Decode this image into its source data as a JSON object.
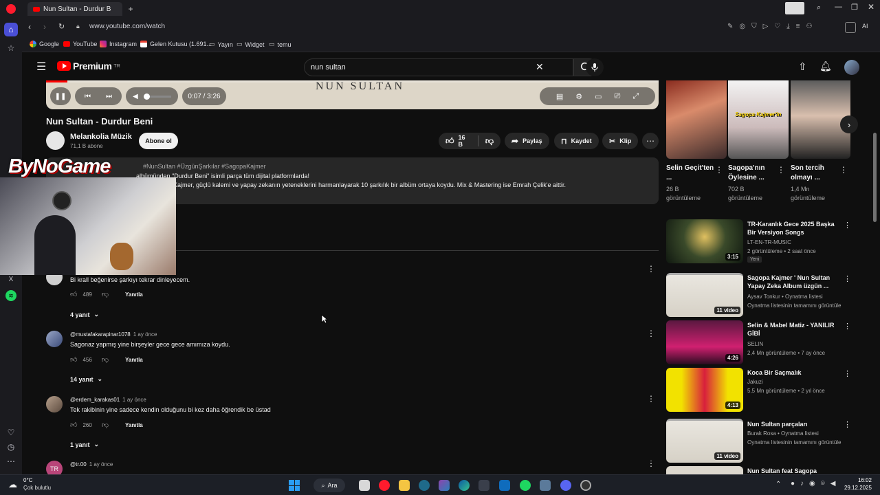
{
  "browser": {
    "tab_title": "Nun Sultan - Durdur B",
    "url": "www.youtube.com/watch",
    "bookmarks": [
      "Google",
      "YouTube",
      "Instagram",
      "Gelen Kutusu (1.691...",
      "Yayın",
      "Widget",
      "temu"
    ],
    "ai_label": "AI"
  },
  "header": {
    "logo": "Premium",
    "logo_region": "TR",
    "search_value": "nun sultan"
  },
  "player": {
    "time": "0:07 / 3:26",
    "video_banner": "NUN SULTAN",
    "progress": 0.035
  },
  "video": {
    "title": "Nun Sultan - Durdur Beni",
    "channel": "Melankolia Müzik",
    "subscribers": "71,1 B abone",
    "subscribe_label": "Abone ol",
    "likes": "16 B",
    "share_label": "Paylaş",
    "save_label": "Kaydet",
    "clip_label": "Klip"
  },
  "description": {
    "tags": "#NunSultan #ÜzgünŞarkılar #SagopaKajmer",
    "line1": "isimli parça tüm dijital platformlarda!",
    "line1_quote": "\"Durdur Beni\"",
    "line1_prefix": "albümünden",
    "line2": "Kajmer, güçlü kalemi ve yapay zekanın yeteneklerini harmanlayarak 10 şarkılık bir albüm ortaya koydu. Mix & Mastering ise Emrah Çelik'e aittir."
  },
  "overlay": {
    "brand": "ByNoGame"
  },
  "comments": [
    {
      "author": "",
      "time": "",
      "text": "Bi krall beğenirse şarkıyı tekrar dinleyecem.",
      "likes": "489",
      "reply_label": "Yanıtla",
      "replies": "4 yanıt"
    },
    {
      "author": "@mustafakarapinar1078",
      "time": "1 ay önce",
      "text": "Sagonaz yapmış yine birşeyler gece gece amımıza koydu.",
      "likes": "456",
      "reply_label": "Yanıtla",
      "replies": "14 yanıt"
    },
    {
      "author": "@erdem_karakas01",
      "time": "1 ay önce",
      "text": "Tek rakibinin yine sadece kendin olduğunu bi kez daha öğrendik be üstad",
      "likes": "260",
      "reply_label": "Yanıtla",
      "replies": "1 yanıt"
    },
    {
      "author": "@tr.00",
      "time": "1 ay önce",
      "text": "",
      "likes": "",
      "reply_label": "",
      "replies": "",
      "initials": "TR"
    }
  ],
  "shorts": [
    {
      "title": "Selin Geçit'ten ...",
      "views": "26 B görüntüleme"
    },
    {
      "title": "Sagopa'nın Öylesine ...",
      "views": "702 B görüntüleme"
    },
    {
      "title": "Son tercih olmayı ...",
      "views": "1,4 Mn görüntüleme"
    }
  ],
  "shorts_thumb_text": "Sagopa Kajmer'in",
  "recommendations": [
    {
      "title": "TR-Karanlık Gece 2025 Başka Bir Versiyon Songs",
      "channel": "LT-EN-TR-MUSIC",
      "meta": "2 görüntüleme • 2 saat önce",
      "badge": "Yeni",
      "duration": "3:15"
    },
    {
      "title": "Sagopa Kajmer ' Nun Sultan Yapay Zeka Album üzgün ...",
      "channel": "Aysav Tonkur • Oynatma listesi",
      "meta": "Oynatma listesinin tamamını görüntüle",
      "badge": "",
      "duration": "11 video"
    },
    {
      "title": "Selin & Mabel Matiz - YANILIR GİBİ",
      "channel": "SELIN",
      "meta": "2,4 Mn görüntüleme • 7 ay önce",
      "badge": "",
      "duration": "4:26"
    },
    {
      "title": "Koca Bir Saçmalık",
      "channel": "Jakuzi",
      "meta": "5,5 Mn görüntüleme • 2 yıl önce",
      "badge": "",
      "duration": "4:13"
    },
    {
      "title": "Nun Sultan parçaları",
      "channel": "Burak Rosa • Oynatma listesi",
      "meta": "Oynatma listesinin tamamını görüntüle",
      "badge": "",
      "duration": "11 video"
    },
    {
      "title": "Nun Sultan feat Sagopa Kajmer",
      "channel": "",
      "meta": "",
      "badge": "",
      "duration": ""
    }
  ],
  "taskbar": {
    "weather_temp": "0°C",
    "weather_desc": "Çok bulutlu",
    "search_label": "Ara",
    "time": "16:02",
    "date": "29.12.2025"
  },
  "colors": {
    "background": "#0f0f0f",
    "youtube_red": "#ff0000",
    "card": "#272727",
    "muted_text": "#aaaaaa"
  }
}
